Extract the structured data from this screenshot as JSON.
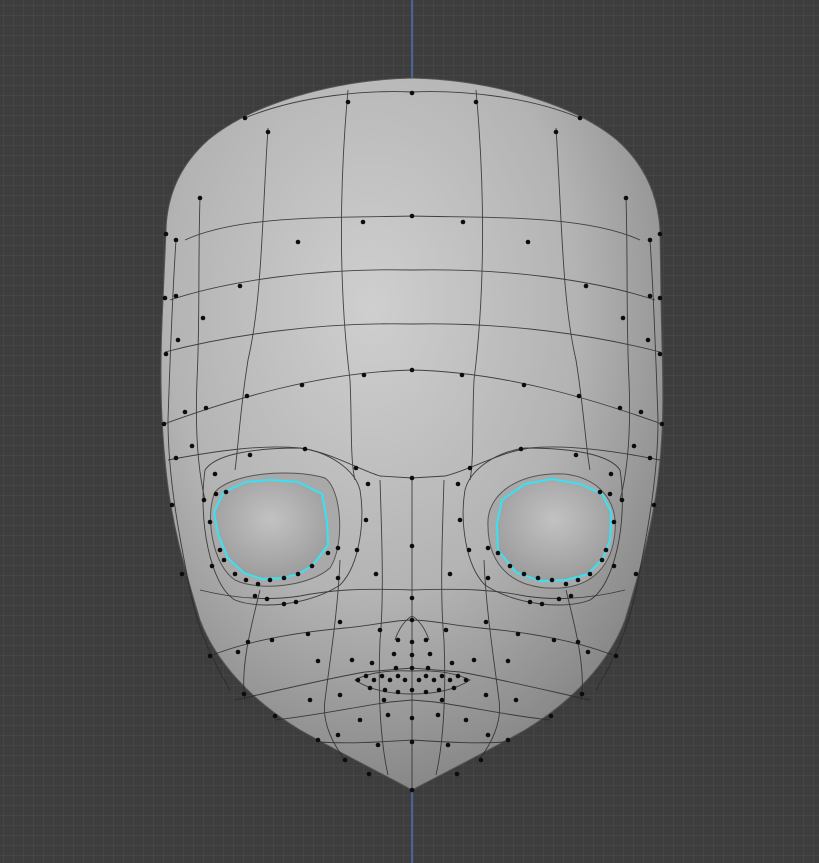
{
  "viewport": {
    "name": "3D Viewport",
    "mode": "edit",
    "object": "head-mesh"
  },
  "colors": {
    "background": "#3d3d3d",
    "grid_minor": "#454545",
    "grid_major": "#2f2f2f",
    "mirror_axis": "#4d79c9",
    "mesh_shade_light": "#c9c9c9",
    "mesh_shade_dark": "#7a7a7a",
    "wire": "#2a2a2a",
    "vertex": "#0c0c0c",
    "selected_edge": "#37e2f2"
  }
}
